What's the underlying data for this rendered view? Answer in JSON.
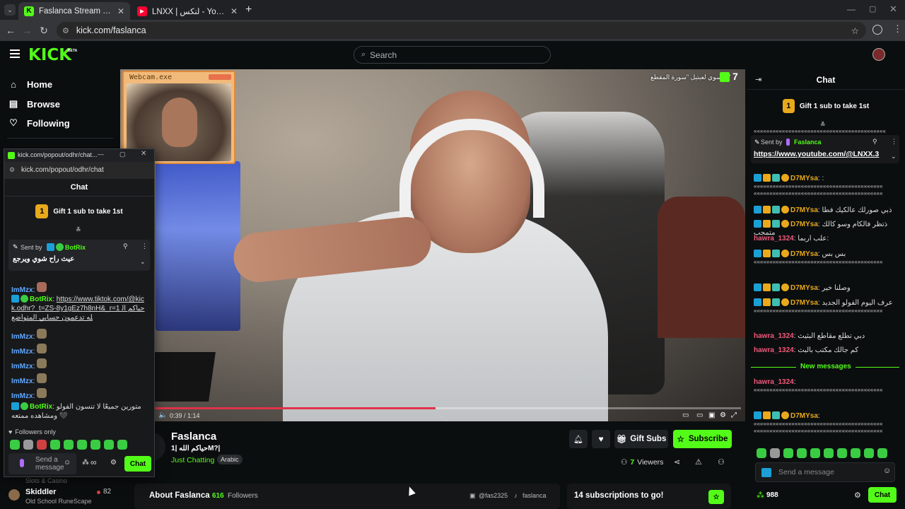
{
  "browser": {
    "tabs": [
      {
        "title": "Faslanca Stream - Watch Live on Kick",
        "favicon": "K"
      },
      {
        "title": "LNXX | لنكس - YouTube",
        "favicon": "▶"
      }
    ],
    "url": "kick.com/faslanca"
  },
  "header": {
    "logo": "KICK",
    "beta": "BETA",
    "search_placeholder": "Search"
  },
  "sidebar": {
    "items": [
      {
        "label": "Home",
        "icon": "home-icon"
      },
      {
        "label": "Browse",
        "icon": "compass-icon"
      },
      {
        "label": "Following",
        "icon": "heart-icon"
      }
    ],
    "channel": {
      "name": "Skiddler",
      "category": "Old School RuneScape",
      "viewers": "82",
      "above": "Slots & Casino"
    }
  },
  "popout": {
    "title": "kick.com/popout/odhr/chat...",
    "url": "kick.com/popout/odhr/chat",
    "chat_title": "Chat",
    "gift_text": "Gift 1 sub to take 1st",
    "gift_badge": "1",
    "pinned": {
      "sent_by": "Sent by",
      "user": "BotRix",
      "text": "عيث راح شوي ويرجع"
    },
    "messages": [
      {
        "user": "ImMzx",
        "text": ":"
      },
      {
        "user": "BotRix",
        "text": "https://www.tiktok.com/@kick.odhr?_t=ZS-8y1gEz7h8nH&_r=1 حياكم الله تدعمون حسابي المتواضع"
      },
      {
        "user": "ImMzx",
        "text": ":"
      },
      {
        "user": "ImMzx",
        "text": ":"
      },
      {
        "user": "ImMzx",
        "text": ":"
      },
      {
        "user": "ImMzx",
        "text": ":"
      },
      {
        "user": "ImMzx",
        "text": ":"
      },
      {
        "user": "BotRix",
        "text": "متورين جميعًا لا تنسون الفولو ومشاهده ممتعه 🖤"
      }
    ],
    "followers_only": "Followers only",
    "send_placeholder": "Send a message",
    "chat_button": "Chat",
    "infinity": "∞"
  },
  "video": {
    "webcam_label": "Webcam.exe",
    "overlay_text": "ر يسوي لعبتيل \"سورة المقطع\"",
    "overlay_num": "7",
    "time": "0:39 / 1:14",
    "progress": 0.48
  },
  "stream": {
    "streamer": "Faslanca",
    "title": "حياكم الله |1M?|",
    "category": "Just Chatting",
    "tag": "Arabic",
    "viewers": "7",
    "viewers_label": "Viewers",
    "gift_subs": "Gift Subs",
    "subscribe": "Subscribe",
    "about": "About Faslanca",
    "followers_count": "616",
    "followers_label": "Followers",
    "instagram": "@fas2325",
    "tiktok": "faslanca",
    "subs_goal": "14 subscriptions to go!"
  },
  "chat": {
    "title": "Chat",
    "gift_text": "Gift 1 sub to take 1st",
    "gift_badge": "1",
    "pinned": {
      "sent_by": "Sent by",
      "user": "Faslanca",
      "link": "https://www.youtube.com/@LNXX.3"
    },
    "messages": [
      {
        "user": "D7MYsa",
        "text": ":",
        "dots": 2,
        "color": "#e8a91c"
      },
      {
        "user": "D7MYsa",
        "text": "ذبي صورلك عالكيك فطا",
        "dots": 0,
        "color": "#e8a91c"
      },
      {
        "user": "D7MYsa",
        "text": "ذتظر فالكام وسو كالك متمجب",
        "dots": 0,
        "color": "#e8a91c"
      },
      {
        "user": "hawra_1324",
        "text": "علب اربما:",
        "dots": 0,
        "color": "#f0587a"
      },
      {
        "user": "D7MYsa",
        "text": "بس بس",
        "dots": 1,
        "color": "#e8a91c"
      },
      {
        "user": "D7MYsa",
        "text": "وصلنا خير",
        "dots": 0,
        "color": "#e8a91c"
      },
      {
        "user": "D7MYsa",
        "text": "عرف اليوم الفولو الجديد",
        "dots": 1,
        "color": "#e8a91c"
      },
      {
        "user": "hawra_1324",
        "text": "دبي تطلع مقاطع البثيث",
        "dots": 0,
        "color": "#f0587a"
      },
      {
        "user": "hawra_1324",
        "text": "كم جالك مكتب بالبث",
        "dots": 0,
        "color": "#f0587a"
      }
    ],
    "new_messages": "New messages",
    "after": [
      {
        "user": "hawra_1324",
        "text": ":",
        "dots": 1,
        "color": "#f0587a"
      },
      {
        "user": "D7MYsa",
        "text": ":",
        "dots": 2,
        "color": "#e8a91c"
      }
    ],
    "send_placeholder": "Send a message",
    "points": "988",
    "chat_button": "Chat"
  },
  "colors": {
    "accent": "#53fc18",
    "background": "#0b0e0f"
  }
}
